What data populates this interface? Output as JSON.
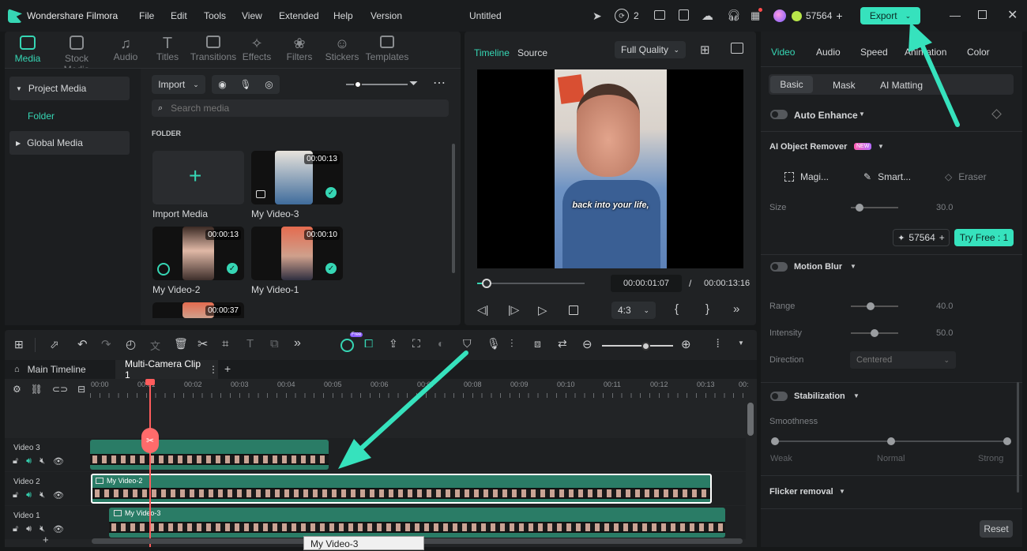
{
  "app": {
    "name": "Wondershare Filmora",
    "doc_title": "Untitled"
  },
  "menu": [
    "File",
    "Edit",
    "Tools",
    "View",
    "Extended",
    "Help",
    "Version"
  ],
  "header": {
    "notif_count": "2",
    "credits": "57564",
    "export_label": "Export"
  },
  "media_tabs": [
    {
      "label": "Media",
      "icon": "media-icon"
    },
    {
      "label": "Stock Media",
      "icon": "stock-media-icon"
    },
    {
      "label": "Audio",
      "icon": "audio-icon"
    },
    {
      "label": "Titles",
      "icon": "titles-icon"
    },
    {
      "label": "Transitions",
      "icon": "transitions-icon"
    },
    {
      "label": "Effects",
      "icon": "effects-icon"
    },
    {
      "label": "Filters",
      "icon": "filters-icon"
    },
    {
      "label": "Stickers",
      "icon": "stickers-icon"
    },
    {
      "label": "Templates",
      "icon": "templates-icon"
    }
  ],
  "library": {
    "project_media": "Project Media",
    "folder": "Folder",
    "global_media": "Global Media"
  },
  "media": {
    "import_label": "Import",
    "search_placeholder": "Search media",
    "folder_heading": "FOLDER",
    "import_media": "Import Media",
    "items": [
      {
        "name": "My Video-3",
        "duration": "00:00:13"
      },
      {
        "name": "My Video-2",
        "duration": "00:00:13"
      },
      {
        "name": "My Video-1",
        "duration": "00:00:10"
      },
      {
        "name": "",
        "duration": "00:00:37"
      }
    ]
  },
  "preview": {
    "tab_timeline": "Timeline",
    "tab_source": "Source",
    "quality": "Full Quality",
    "caption": "back into your life,",
    "current_time": "00:00:01:07",
    "separator": "/",
    "total_time": "00:00:13:16",
    "aspect": "4:3",
    "playhead_fraction": 0.09
  },
  "props": {
    "tabs": [
      "Video",
      "Audio",
      "Speed",
      "Animation",
      "Color"
    ],
    "subtabs": [
      "Basic",
      "Mask",
      "AI Matting"
    ],
    "auto_enhance": "Auto Enhance",
    "ai_remover": {
      "label": "AI Object Remover",
      "badge": "NEW",
      "tools": [
        "Magi...",
        "Smart...",
        "Eraser"
      ],
      "size_label": "Size",
      "size_value": "30.0",
      "size_fraction": 0.1
    },
    "credits": "57564",
    "try_free": "Try Free : 1",
    "motion_blur": {
      "label": "Motion Blur",
      "range_label": "Range",
      "range_value": "40.0",
      "intensity_label": "Intensity",
      "intensity_value": "50.0",
      "direction_label": "Direction",
      "direction_value": "Centered"
    },
    "stabilization": {
      "label": "Stabilization",
      "smoothness": "Smoothness",
      "levels": [
        "Weak",
        "Normal",
        "Strong"
      ]
    },
    "flicker": "Flicker removal",
    "reset": "Reset"
  },
  "timeline": {
    "tabs": [
      "Main Timeline",
      "Multi-Camera Clip 1"
    ],
    "ruler": [
      "00:00",
      "00:01",
      "00:02",
      "00:03",
      "00:04",
      "00:05",
      "00:06",
      "00:07",
      "00:08",
      "00:09",
      "00:10",
      "00:11",
      "00:12",
      "00:13",
      "00:"
    ],
    "tracks": [
      {
        "name": "Video 3",
        "clip": ""
      },
      {
        "name": "Video 2",
        "clip": "My Video-2"
      },
      {
        "name": "Video 1",
        "clip": "My Video-3"
      }
    ],
    "tooltip": "My Video-3",
    "free_badge": "Free"
  },
  "colors": {
    "accent": "#36d6b4",
    "clip_green": "#2a7c66",
    "playhead": "#ff5c5c"
  }
}
